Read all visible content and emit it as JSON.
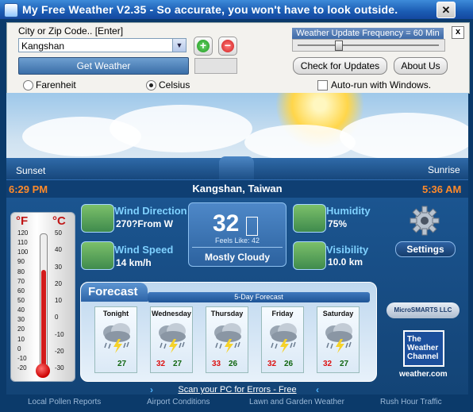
{
  "window": {
    "title": "My Free Weather V2.35 -  So accurate, you won't have to look outside.",
    "close_glyph": "✕"
  },
  "controls": {
    "city_label": "City or Zip Code..  [Enter]",
    "city_value": "Kangshan",
    "add_glyph": "+",
    "remove_glyph": "−",
    "get_weather_label": "Get Weather",
    "unit_fahrenheit": "Farenheit",
    "unit_celsius": "Celsius",
    "selected_unit": "celsius",
    "update_frequency_label": "Weather Update Frequency = 60 Min",
    "update_frequency_minutes": 60,
    "check_updates_label": "Check for Updates",
    "about_label": "About Us",
    "close_panel_glyph": "x",
    "autorun_label": "Auto-run with Windows.",
    "autorun_checked": false
  },
  "sky": {
    "sunset_label": "Sunset",
    "sunrise_label": "Sunrise"
  },
  "info": {
    "sunset_time": "6:29 PM",
    "location": "Kangshan, Taiwan",
    "sunrise_time": "5:36 AM"
  },
  "current": {
    "wind_direction_title": "Wind Direction",
    "wind_direction_value": "270?From W",
    "wind_speed_title": "Wind Speed",
    "wind_speed_value": "14 km/h",
    "humidity_title": "Humidity",
    "humidity_value": "75%",
    "visibility_title": "Visibility",
    "visibility_value": "10.0 km",
    "temperature": "32",
    "feels_like": "Feels Like: 42",
    "condition": "Mostly Cloudy"
  },
  "thermometer": {
    "f_label": "°F",
    "c_label": "°C",
    "f_ticks": [
      "120",
      "110",
      "100",
      "90",
      "80",
      "70",
      "60",
      "50",
      "40",
      "30",
      "20",
      "10",
      "0",
      "-10",
      "-20"
    ],
    "c_ticks": [
      "50",
      "40",
      "30",
      "20",
      "10",
      "0",
      "-10",
      "-20",
      "-30"
    ],
    "level_fraction": 0.74
  },
  "settings_label": "Settings",
  "forecast": {
    "tab_label": "Forecast",
    "header": "5-Day Forecast",
    "days": [
      {
        "name": "Tonight",
        "hi": "",
        "lo": "27"
      },
      {
        "name": "Wednesday",
        "hi": "32",
        "lo": "27"
      },
      {
        "name": "Thursday",
        "hi": "33",
        "lo": "26"
      },
      {
        "name": "Friday",
        "hi": "32",
        "lo": "26"
      },
      {
        "name": "Saturday",
        "hi": "32",
        "lo": "27"
      }
    ]
  },
  "brand": {
    "microsmarts": "MicroSMARTS LLC",
    "twc_line1": "The",
    "twc_line2": "Weather",
    "twc_line3": "Channel",
    "twc_url": "weather.com"
  },
  "scan": {
    "label": "Scan your PC for Errors - Free",
    "chevron_right": "›",
    "chevron_left": "‹"
  },
  "bottom_links": [
    "Local Pollen Reports",
    "Airport Conditions",
    "Lawn and Garden Weather",
    "Rush Hour Traffic"
  ],
  "colors": {
    "accent_blue": "#1b5590",
    "time_orange": "#ff8a2a",
    "title_cyan": "#7fd1ff"
  }
}
